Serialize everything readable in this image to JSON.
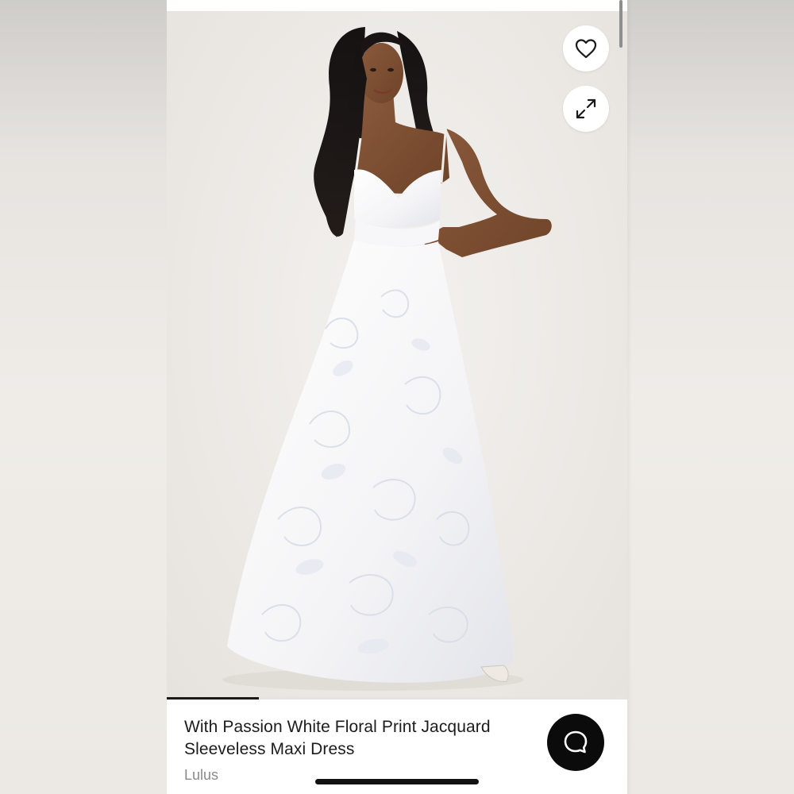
{
  "product": {
    "title": "With Passion White Floral Print Jacquard Sleeveless Maxi Dress",
    "brand": "Lulus"
  },
  "gallery": {
    "progress_fraction": 0.2
  },
  "icons": {
    "favorite": "heart-outline-icon",
    "expand": "expand-arrows-icon",
    "chat": "chat-bubble-icon"
  },
  "colors": {
    "chat_button_bg": "#0b0b0b",
    "progress_fill": "#1a1a1a",
    "brand_text": "#8a8a8a"
  }
}
